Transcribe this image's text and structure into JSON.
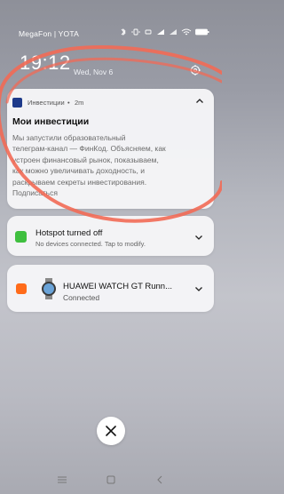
{
  "status_bar": {
    "carrier": "MegaFon | YOTA",
    "battery": "100"
  },
  "lockscreen": {
    "time": "19:12",
    "date": "Wed, Nov 6"
  },
  "notifications": [
    {
      "app": "Инвестиции",
      "separator": "•",
      "time": "2m",
      "title": "Мои инвестиции",
      "body_lines": [
        "Мы запустили образовательный",
        "телеграм-канал — ФинКод. Объясняем, как",
        "устроен финансовый рынок, показываем,",
        "как можно увеличивать доходность, и",
        "раскрываем секреты инвестирования.",
        "Подписаться"
      ],
      "icon": "investments-app-icon",
      "accent": "#1e3a8a"
    },
    {
      "title": "Hotspot turned off",
      "subtitle": "No devices connected. Tap to modify.",
      "icon": "hotspot-icon",
      "accent": "#3fbf3f"
    },
    {
      "title": "HUAWEI WATCH GT Runn...",
      "subtitle": "Connected",
      "icon": "health-app-icon",
      "accent": "#ff6b1a"
    }
  ],
  "colors": {
    "annotation_stroke": "#f26a55"
  }
}
